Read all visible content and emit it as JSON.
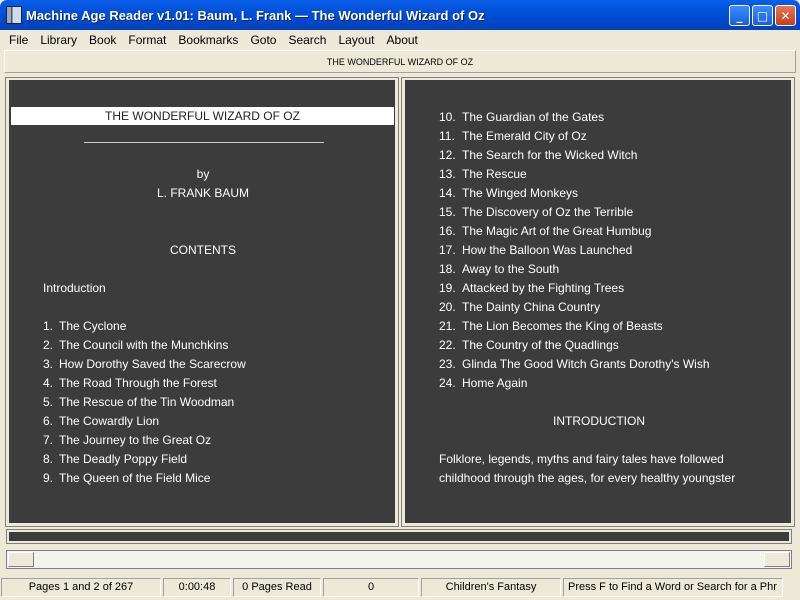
{
  "window": {
    "title": "Machine Age Reader v1.01: Baum, L. Frank — The Wonderful Wizard of Oz",
    "buttons": {
      "minimize": "_",
      "maximize": "□",
      "close": "✕"
    }
  },
  "menu": [
    "File",
    "Library",
    "Book",
    "Format",
    "Bookmarks",
    "Goto",
    "Search",
    "Layout",
    "About"
  ],
  "header_title": "THE WONDERFUL WIZARD OF OZ",
  "left_page": {
    "book_title": "THE WONDERFUL WIZARD OF OZ",
    "by": "by",
    "author": "L. FRANK BAUM",
    "contents_heading": "CONTENTS",
    "introduction": "Introduction",
    "chapters": [
      {
        "n": "1.",
        "t": "The Cyclone"
      },
      {
        "n": "2.",
        "t": "The Council with the Munchkins"
      },
      {
        "n": "3.",
        "t": "How Dorothy Saved the Scarecrow"
      },
      {
        "n": "4.",
        "t": "The Road Through the Forest"
      },
      {
        "n": "5.",
        "t": "The Rescue of the Tin Woodman"
      },
      {
        "n": "6.",
        "t": "The Cowardly Lion"
      },
      {
        "n": "7.",
        "t": "The Journey to the Great Oz"
      },
      {
        "n": "8.",
        "t": "The Deadly Poppy Field"
      },
      {
        "n": "9.",
        "t": "The Queen of the Field Mice"
      }
    ]
  },
  "right_page": {
    "chapters": [
      {
        "n": "10.",
        "t": "The Guardian of the Gates"
      },
      {
        "n": "11.",
        "t": "The Emerald City of Oz"
      },
      {
        "n": "12.",
        "t": "The Search for the Wicked Witch"
      },
      {
        "n": "13.",
        "t": "The Rescue"
      },
      {
        "n": "14.",
        "t": "The Winged Monkeys"
      },
      {
        "n": "15.",
        "t": "The Discovery of Oz the Terrible"
      },
      {
        "n": "16.",
        "t": "The Magic Art of the Great Humbug"
      },
      {
        "n": "17.",
        "t": "How the Balloon Was Launched"
      },
      {
        "n": "18.",
        "t": "Away to the South"
      },
      {
        "n": "19.",
        "t": "Attacked by the Fighting Trees"
      },
      {
        "n": "20.",
        "t": "The Dainty China Country"
      },
      {
        "n": "21.",
        "t": "The Lion Becomes the King of Beasts"
      },
      {
        "n": "22.",
        "t": "The Country of the Quadlings"
      },
      {
        "n": "23.",
        "t": "Glinda The Good Witch Grants Dorothy's Wish"
      },
      {
        "n": "24.",
        "t": "Home Again"
      }
    ],
    "intro_heading": "INTRODUCTION",
    "intro_lines": [
      "Folklore, legends, myths and fairy tales have followed",
      "childhood through the ages, for every healthy youngster"
    ]
  },
  "progress_fraction": 1.0,
  "status": {
    "pages": "Pages 1 and 2 of 267",
    "time": "0:00:48",
    "pages_read": "0 Pages Read",
    "count": "0",
    "genre": "Children's Fantasy",
    "hint": "Press F to Find a Word or Search for a Phr"
  },
  "colors": {
    "page_bg": "#3c3c3c",
    "page_text": "#ffffff",
    "titlebar": "#0050d8",
    "chrome": "#ece9d8"
  }
}
